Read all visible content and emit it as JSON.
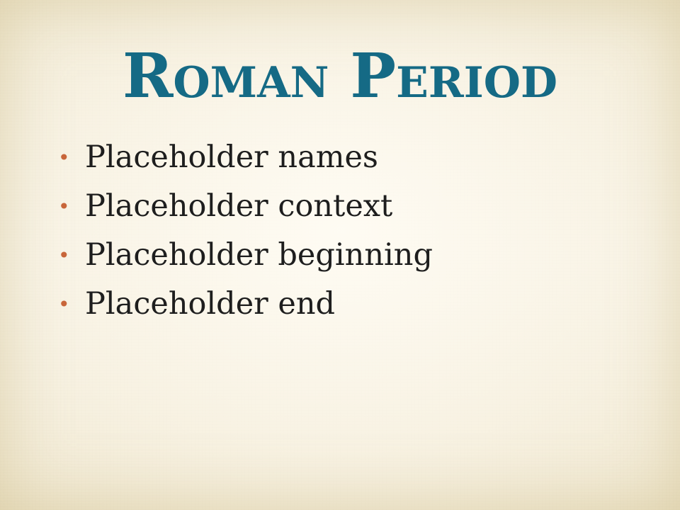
{
  "slide": {
    "title": "Roman Period",
    "bullet_symbol": "•",
    "bullets": [
      "Placeholder names",
      "Placeholder context",
      "Placeholder beginning",
      "Placeholder end"
    ]
  },
  "colors": {
    "title": "#156a85",
    "bullet": "#c8663a",
    "text": "#1e1e1e",
    "background": "#f6f0df"
  }
}
